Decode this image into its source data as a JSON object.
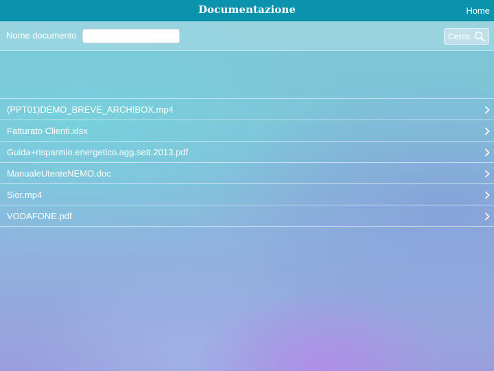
{
  "navbar": {
    "title": "Documentazione",
    "home_label": "Home",
    "color": "#0b92ac"
  },
  "search": {
    "label": "Nome documento",
    "value": "",
    "placeholder": "",
    "button_label": "Cerca",
    "button_icon": "search-icon"
  },
  "documents": [
    {
      "name": "(PPT01)DEMO_BREVE_ARCHIBOX.mp4",
      "icon": "chevron-right-icon"
    },
    {
      "name": "Fatturato Clienti.xlsx",
      "icon": "chevron-right-icon"
    },
    {
      "name": "Guida+risparmio.energetico.agg.sett.2013.pdf",
      "icon": "chevron-right-icon"
    },
    {
      "name": "ManualeUtenteNEMO.doc",
      "icon": "chevron-right-icon"
    },
    {
      "name": "Sior.mp4",
      "icon": "chevron-right-icon"
    },
    {
      "name": "VODAFONE.pdf",
      "icon": "chevron-right-icon"
    }
  ]
}
